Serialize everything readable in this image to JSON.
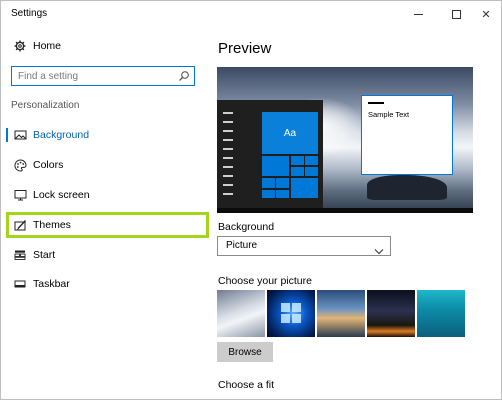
{
  "window": {
    "title": "Settings",
    "minimize_label": "",
    "maximize_label": "",
    "close_label": "✕"
  },
  "sidebar": {
    "home_label": "Home",
    "search": {
      "placeholder": "Find a setting"
    },
    "section_heading": "Personalization",
    "items": [
      {
        "label": "Background",
        "icon": "picture-icon",
        "active": true
      },
      {
        "label": "Colors",
        "icon": "palette-icon"
      },
      {
        "label": "Lock screen",
        "icon": "monitor-icon"
      },
      {
        "label": "Themes",
        "icon": "brush-icon"
      },
      {
        "label": "Start",
        "icon": "start-icon"
      },
      {
        "label": "Taskbar",
        "icon": "taskbar-icon"
      }
    ],
    "highlight_color": "#a2d51c"
  },
  "main": {
    "preview_title": "Preview",
    "preview": {
      "tile_label": "Aa",
      "sample_text": "Sample Text"
    },
    "background_label": "Background",
    "background_value": "Picture",
    "choose_picture_label": "Choose your picture",
    "browse_label": "Browse",
    "choose_fit_label": "Choose a fit"
  },
  "colors": {
    "accent": "#0078d7"
  }
}
